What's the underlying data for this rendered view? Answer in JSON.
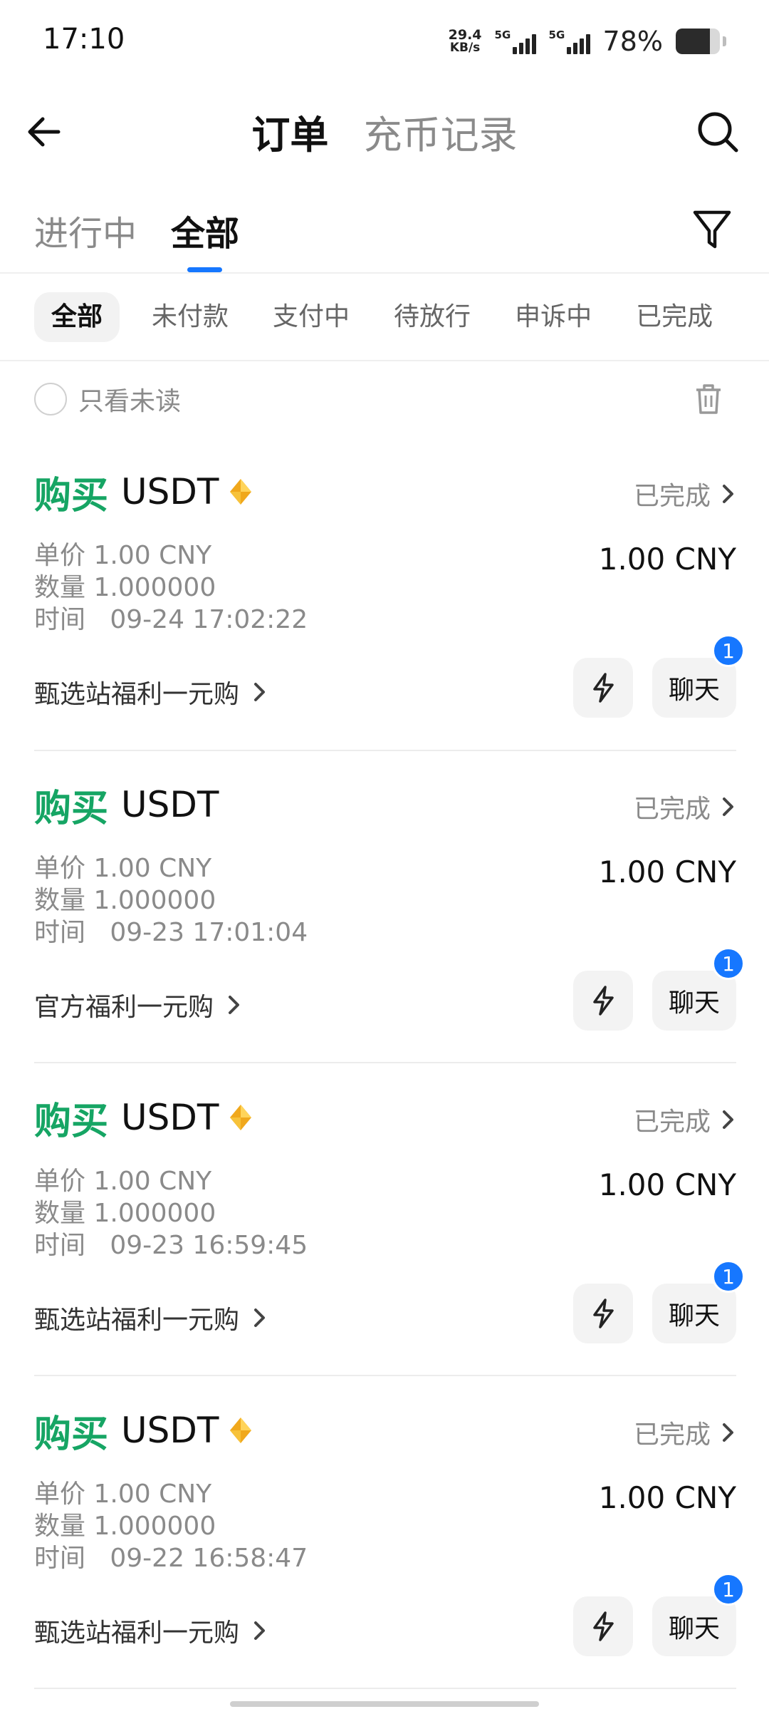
{
  "status_bar": {
    "time": "17:10",
    "net_speed_value": "29.4",
    "net_speed_unit": "KB/s",
    "signal1_label": "5G",
    "signal2_label": "5G",
    "battery_percent": "78%",
    "battery_level": 0.78
  },
  "header": {
    "tabs": [
      {
        "label": "订单",
        "active": true
      },
      {
        "label": "充币记录",
        "active": false
      }
    ],
    "icons": [
      "back-arrow-icon",
      "search-icon"
    ]
  },
  "scope_tabs": [
    {
      "label": "进行中",
      "active": false
    },
    {
      "label": "全部",
      "active": true
    }
  ],
  "status_filters": [
    {
      "label": "全部",
      "active": true
    },
    {
      "label": "未付款",
      "active": false
    },
    {
      "label": "支付中",
      "active": false
    },
    {
      "label": "待放行",
      "active": false
    },
    {
      "label": "申诉中",
      "active": false
    },
    {
      "label": "已完成",
      "active": false
    }
  ],
  "unread_only_label": "只看未读",
  "accent_colors": {
    "buy": "#16a564",
    "brand": "#1677ff"
  },
  "orders": [
    {
      "side": "购买",
      "coin": "USDT",
      "vip": true,
      "status": "已完成",
      "price_label": "单价",
      "price": "1.00 CNY",
      "qty_label": "数量",
      "qty": "1.000000",
      "time_label": "时间",
      "time": "09-24 17:02:22",
      "total": "1.00 CNY",
      "promo": "甄选站福利一元购",
      "chat_label": "聊天",
      "unread": "1"
    },
    {
      "side": "购买",
      "coin": "USDT",
      "vip": false,
      "status": "已完成",
      "price_label": "单价",
      "price": "1.00 CNY",
      "qty_label": "数量",
      "qty": "1.000000",
      "time_label": "时间",
      "time": "09-23 17:01:04",
      "total": "1.00 CNY",
      "promo": "官方福利一元购",
      "chat_label": "聊天",
      "unread": "1"
    },
    {
      "side": "购买",
      "coin": "USDT",
      "vip": true,
      "status": "已完成",
      "price_label": "单价",
      "price": "1.00 CNY",
      "qty_label": "数量",
      "qty": "1.000000",
      "time_label": "时间",
      "time": "09-23 16:59:45",
      "total": "1.00 CNY",
      "promo": "甄选站福利一元购",
      "chat_label": "聊天",
      "unread": "1"
    },
    {
      "side": "购买",
      "coin": "USDT",
      "vip": true,
      "status": "已完成",
      "price_label": "单价",
      "price": "1.00 CNY",
      "qty_label": "数量",
      "qty": "1.000000",
      "time_label": "时间",
      "time": "09-22 16:58:47",
      "total": "1.00 CNY",
      "promo": "甄选站福利一元购",
      "chat_label": "聊天",
      "unread": "1"
    }
  ]
}
